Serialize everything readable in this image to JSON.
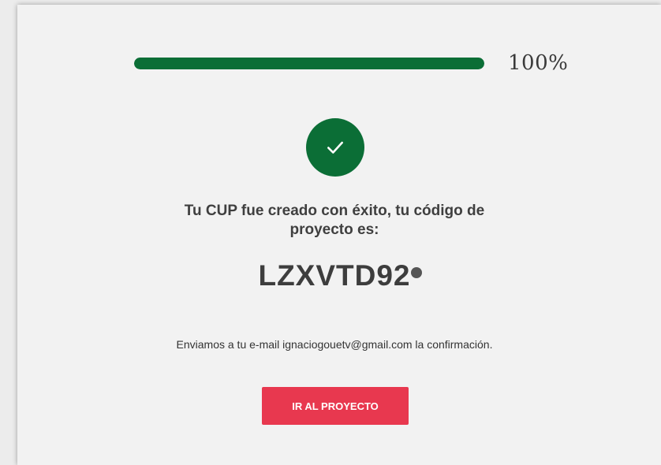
{
  "progress": {
    "value": 100,
    "label": "100%",
    "fill_color": "#0b6e36",
    "track_color": "#d8d8d8"
  },
  "success": {
    "icon": "check-icon",
    "circle_color": "#0b6e36",
    "message": "Tu CUP fue creado con éxito, tu código de proyecto es:",
    "project_code": "LZXVTD92"
  },
  "email_note": "Enviamos a tu e-mail ignaciogouetv@gmail.com la confirmación.",
  "cta": {
    "label": "IR AL PROYECTO",
    "color": "#e8384f"
  }
}
